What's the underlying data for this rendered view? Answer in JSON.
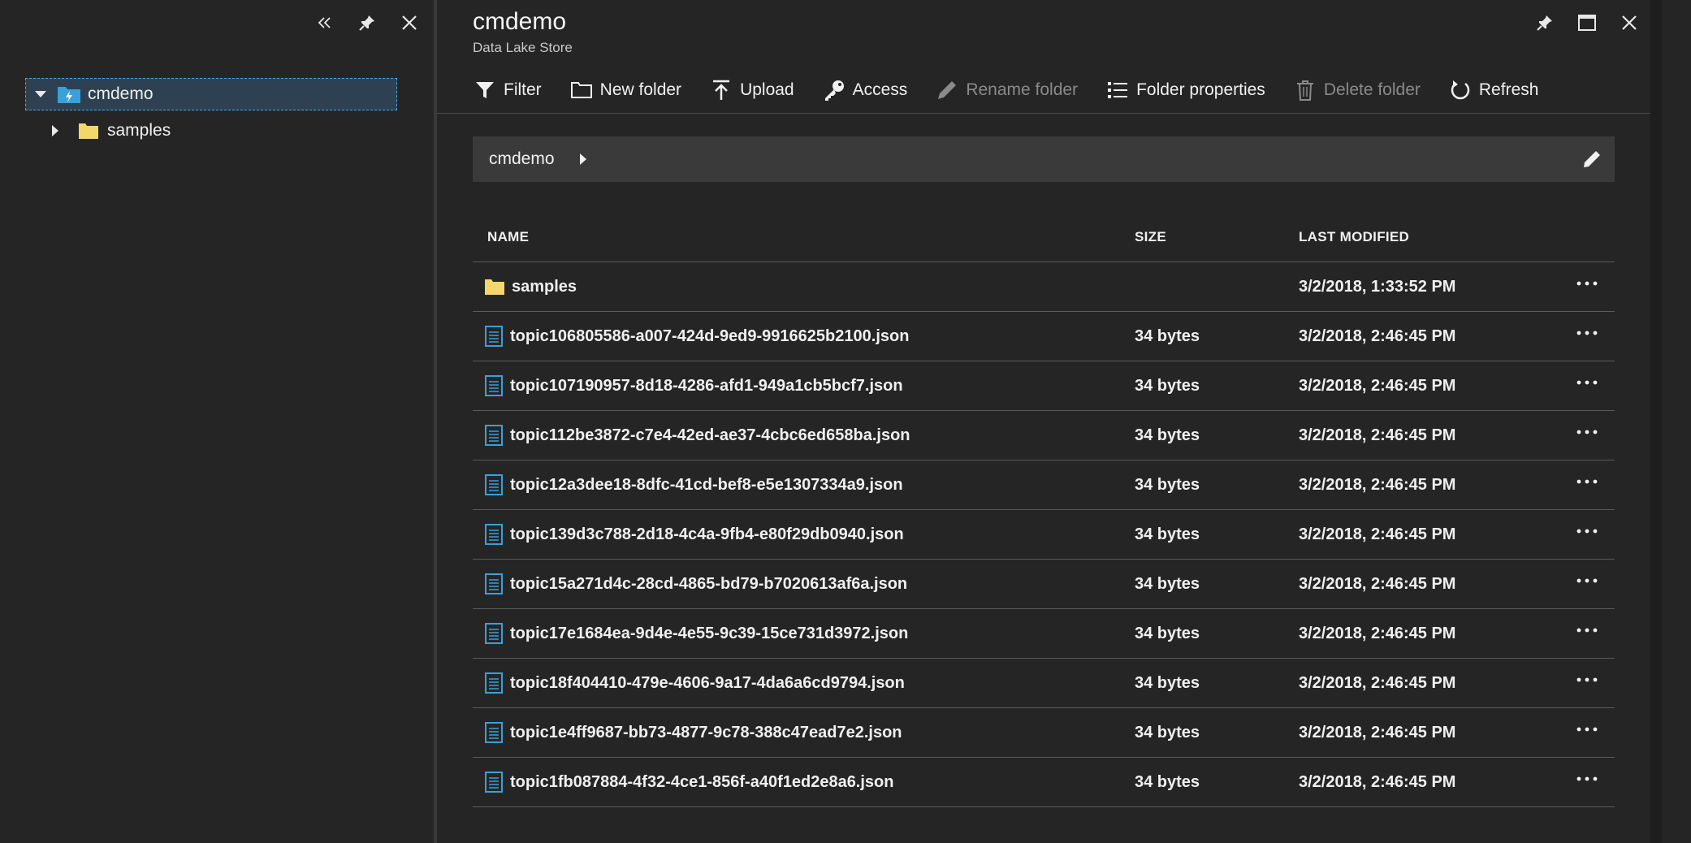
{
  "left_panel": {
    "controls": [
      {
        "name": "collapse",
        "icon": "double-chevron-left-icon"
      },
      {
        "name": "pin",
        "icon": "pin-icon"
      },
      {
        "name": "close",
        "icon": "close-icon"
      }
    ],
    "tree": {
      "root": {
        "label": "cmdemo",
        "icon": "data-lake-folder-icon",
        "expanded": true,
        "selected": true
      },
      "children": [
        {
          "label": "samples",
          "icon": "folder-icon",
          "expanded": false
        }
      ]
    }
  },
  "blade": {
    "title": "cmdemo",
    "subtitle": "Data Lake Store",
    "controls": [
      {
        "name": "pin",
        "icon": "pin-icon"
      },
      {
        "name": "maximize",
        "icon": "maximize-icon"
      },
      {
        "name": "close",
        "icon": "close-icon"
      }
    ]
  },
  "toolbar": {
    "filter": "Filter",
    "new_folder": "New folder",
    "upload": "Upload",
    "access": "Access",
    "rename_folder": "Rename folder",
    "folder_properties": "Folder properties",
    "delete_folder": "Delete folder",
    "refresh": "Refresh"
  },
  "breadcrumb": {
    "path": "cmdemo"
  },
  "table": {
    "headers": {
      "name": "NAME",
      "size": "SIZE",
      "modified": "LAST MODIFIED"
    },
    "rows": [
      {
        "type": "folder",
        "name": "samples",
        "size": "",
        "modified": "3/2/2018, 1:33:52 PM"
      },
      {
        "type": "file",
        "name": "topic106805586-a007-424d-9ed9-9916625b2100.json",
        "size": "34 bytes",
        "modified": "3/2/2018, 2:46:45 PM"
      },
      {
        "type": "file",
        "name": "topic107190957-8d18-4286-afd1-949a1cb5bcf7.json",
        "size": "34 bytes",
        "modified": "3/2/2018, 2:46:45 PM"
      },
      {
        "type": "file",
        "name": "topic112be3872-c7e4-42ed-ae37-4cbc6ed658ba.json",
        "size": "34 bytes",
        "modified": "3/2/2018, 2:46:45 PM"
      },
      {
        "type": "file",
        "name": "topic12a3dee18-8dfc-41cd-bef8-e5e1307334a9.json",
        "size": "34 bytes",
        "modified": "3/2/2018, 2:46:45 PM"
      },
      {
        "type": "file",
        "name": "topic139d3c788-2d18-4c4a-9fb4-e80f29db0940.json",
        "size": "34 bytes",
        "modified": "3/2/2018, 2:46:45 PM"
      },
      {
        "type": "file",
        "name": "topic15a271d4c-28cd-4865-bd79-b7020613af6a.json",
        "size": "34 bytes",
        "modified": "3/2/2018, 2:46:45 PM"
      },
      {
        "type": "file",
        "name": "topic17e1684ea-9d4e-4e55-9c39-15ce731d3972.json",
        "size": "34 bytes",
        "modified": "3/2/2018, 2:46:45 PM"
      },
      {
        "type": "file",
        "name": "topic18f404410-479e-4606-9a17-4da6a6cd9794.json",
        "size": "34 bytes",
        "modified": "3/2/2018, 2:46:45 PM"
      },
      {
        "type": "file",
        "name": "topic1e4ff9687-bb73-4877-9c78-388c47ead7e2.json",
        "size": "34 bytes",
        "modified": "3/2/2018, 2:46:45 PM"
      },
      {
        "type": "file",
        "name": "topic1fb087884-4f32-4ce1-856f-a40f1ed2e8a6.json",
        "size": "34 bytes",
        "modified": "3/2/2018, 2:46:45 PM"
      }
    ]
  },
  "colors": {
    "background": "#252526",
    "accent": "#4aa3df",
    "folder": "#f5d66b",
    "file_icon": "#3aa0d8",
    "disabled_text": "#8a8a8a"
  }
}
